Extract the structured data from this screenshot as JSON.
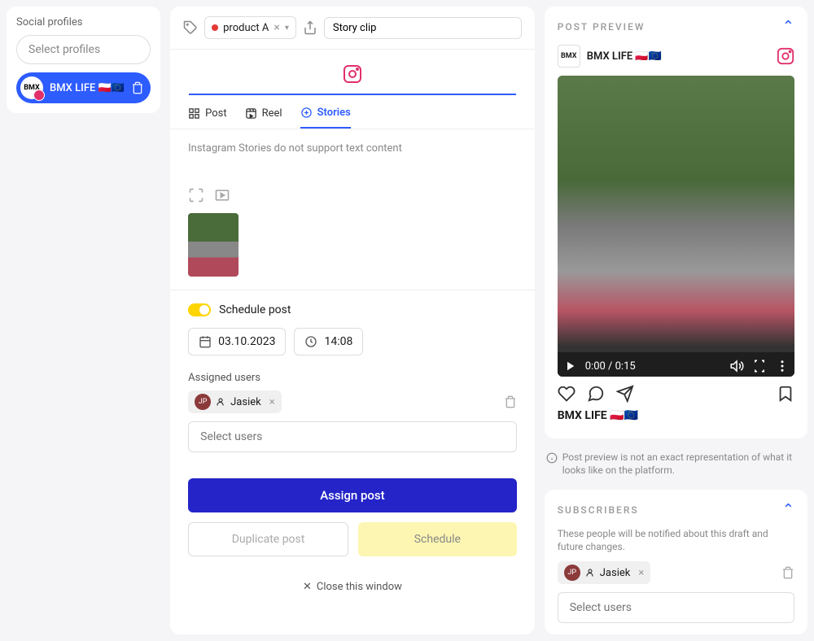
{
  "sidebar": {
    "label": "Social profiles",
    "select_placeholder": "Select profiles",
    "profile": {
      "name": "BMX LIFE 🇵🇱🇪🇺"
    }
  },
  "editor": {
    "tag": "product A",
    "title_value": "Story clip",
    "tabs": {
      "post": "Post",
      "reel": "Reel",
      "stories": "Stories"
    },
    "hint": "Instagram Stories do not support text content",
    "schedule_label": "Schedule post",
    "date": "03.10.2023",
    "time": "14:08",
    "assigned_label": "Assigned users",
    "assigned_user": {
      "initials": "JP",
      "name": "Jasiek"
    },
    "select_users_placeholder": "Select users",
    "btn_assign": "Assign post",
    "btn_duplicate": "Duplicate post",
    "btn_schedule": "Schedule",
    "close_link": "Close this window"
  },
  "preview": {
    "title": "POST PREVIEW",
    "profile_name": "BMX LIFE 🇵🇱🇪🇺",
    "video_time": "0:00 / 0:15",
    "caption": "BMX LIFE 🇵🇱🇪🇺",
    "disclaimer": "Post preview is not an exact representation of what it looks like on the platform."
  },
  "subscribers": {
    "title": "SUBSCRIBERS",
    "desc": "These people will be notified about this draft and future changes.",
    "user": {
      "initials": "JP",
      "name": "Jasiek"
    },
    "select_placeholder": "Select users"
  }
}
